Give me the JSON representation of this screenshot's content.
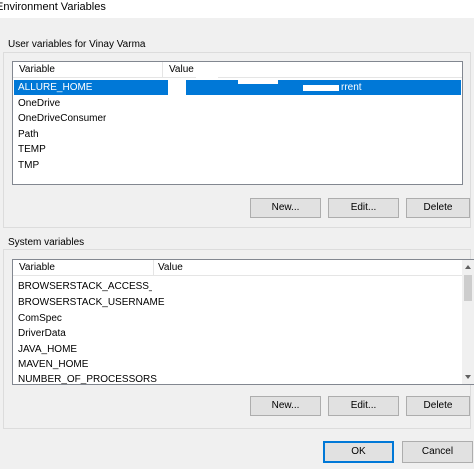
{
  "window": {
    "title": "Environment Variables"
  },
  "user_vars": {
    "label": "User variables for Vinay Varma",
    "columns": [
      "Variable",
      "Value"
    ],
    "rows": [
      {
        "variable": "ALLURE_HOME",
        "value": "rrent",
        "selected": true
      },
      {
        "variable": "OneDrive",
        "value": ""
      },
      {
        "variable": "OneDriveConsumer",
        "value": ""
      },
      {
        "variable": "Path",
        "value": ""
      },
      {
        "variable": "TEMP",
        "value": ""
      },
      {
        "variable": "TMP",
        "value": ""
      }
    ],
    "buttons": {
      "new": "New...",
      "edit": "Edit...",
      "delete": "Delete"
    }
  },
  "system_vars": {
    "label": "System variables",
    "columns": [
      "Variable",
      "Value"
    ],
    "rows": [
      {
        "variable": "BROWSERSTACK_ACCESS_KEY",
        "value": ""
      },
      {
        "variable": "BROWSERSTACK_USERNAME",
        "value": ""
      },
      {
        "variable": "ComSpec",
        "value": ""
      },
      {
        "variable": "DriverData",
        "value": ""
      },
      {
        "variable": "JAVA_HOME",
        "value": ""
      },
      {
        "variable": "MAVEN_HOME",
        "value": ""
      },
      {
        "variable": "NUMBER_OF_PROCESSORS",
        "value": ""
      }
    ],
    "buttons": {
      "new": "New...",
      "edit": "Edit...",
      "delete": "Delete"
    }
  },
  "dialog_buttons": {
    "ok": "OK",
    "cancel": "Cancel"
  },
  "colors": {
    "selection": "#0078d7",
    "background": "#f0f0f0"
  }
}
